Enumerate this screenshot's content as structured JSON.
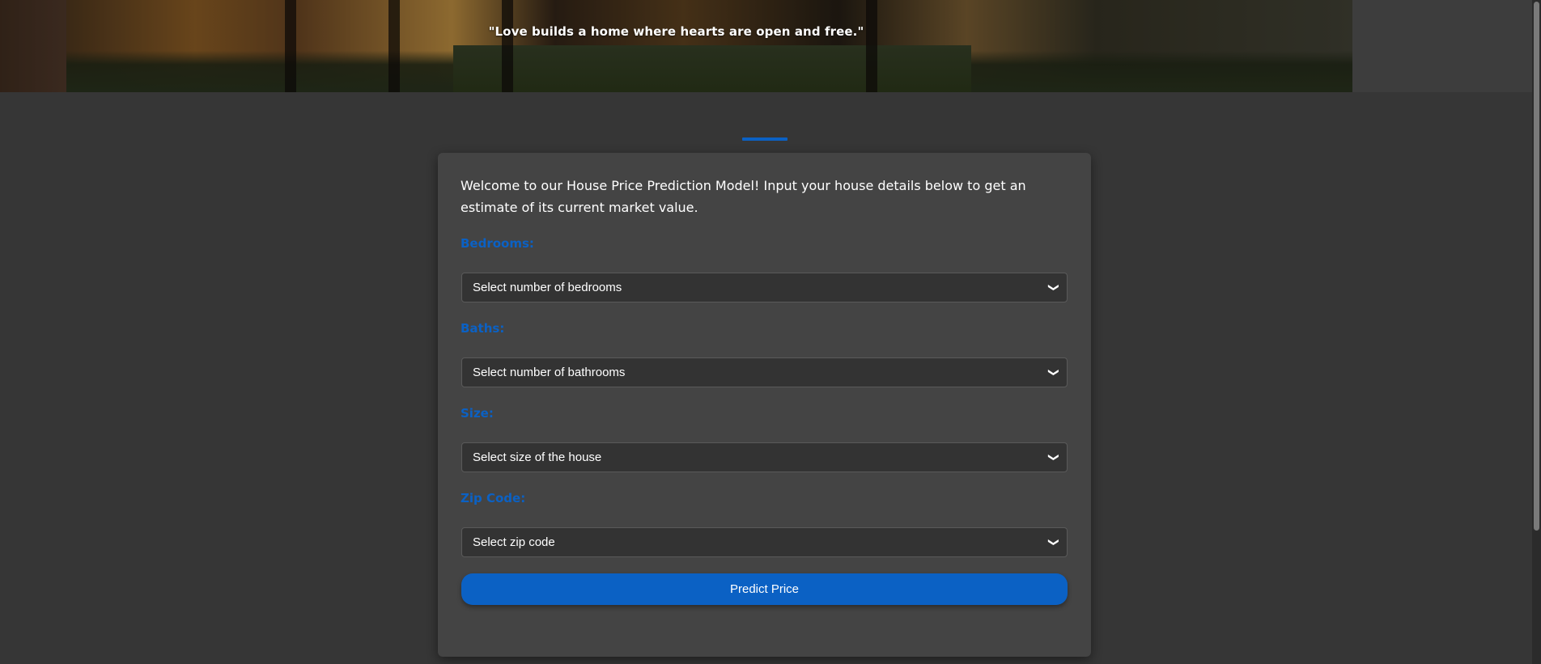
{
  "hero": {
    "quote": "\"Love builds a home where hearts are open and free.\""
  },
  "form": {
    "intro": "Welcome to our House Price Prediction Model! Input your house details below to get an estimate of its current market value.",
    "fields": [
      {
        "label": "Bedrooms:",
        "selected": "Select number of bedrooms"
      },
      {
        "label": "Baths:",
        "selected": "Select number of bathrooms"
      },
      {
        "label": "Size:",
        "selected": "Select size of the house"
      },
      {
        "label": "Zip Code:",
        "selected": "Select zip code"
      }
    ],
    "submit_label": "Predict Price"
  },
  "colors": {
    "accent": "#0b61c4",
    "background": "#363636",
    "card": "#444444",
    "select_bg": "#333333"
  }
}
